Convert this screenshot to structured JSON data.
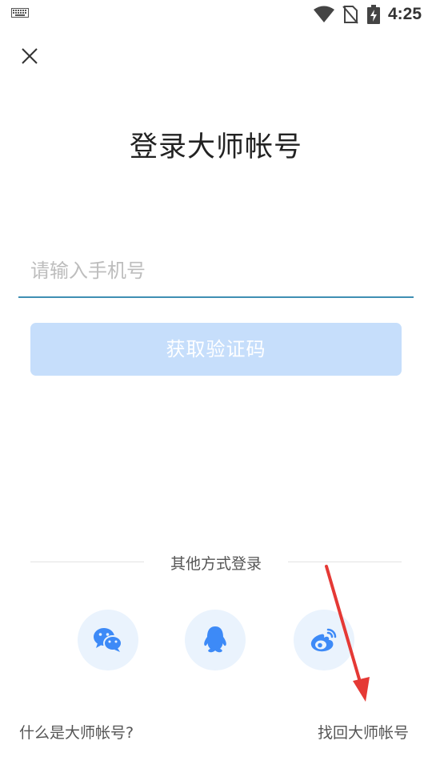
{
  "status_bar": {
    "time": "4:25",
    "icons": [
      "keyboard-icon",
      "wifi-icon",
      "no-sim-icon",
      "battery-charging-icon"
    ]
  },
  "header": {
    "close_icon": "close-icon",
    "title": "登录大师帐号"
  },
  "form": {
    "phone_placeholder": "请输入手机号",
    "phone_value": "",
    "get_code_label": "获取验证码"
  },
  "other_login": {
    "label": "其他方式登录",
    "providers": [
      {
        "name": "wechat",
        "icon": "wechat-icon"
      },
      {
        "name": "qq",
        "icon": "qq-icon"
      },
      {
        "name": "weibo",
        "icon": "weibo-icon"
      }
    ]
  },
  "footer": {
    "what_is_label": "什么是大师帐号?",
    "recover_label": "找回大师帐号"
  },
  "colors": {
    "accent_blue": "#3d8af7",
    "button_disabled_bg": "#c6defb",
    "input_underline": "#3f8fb3",
    "social_bg": "#eaf3fd",
    "annotation_red": "#e53935"
  }
}
